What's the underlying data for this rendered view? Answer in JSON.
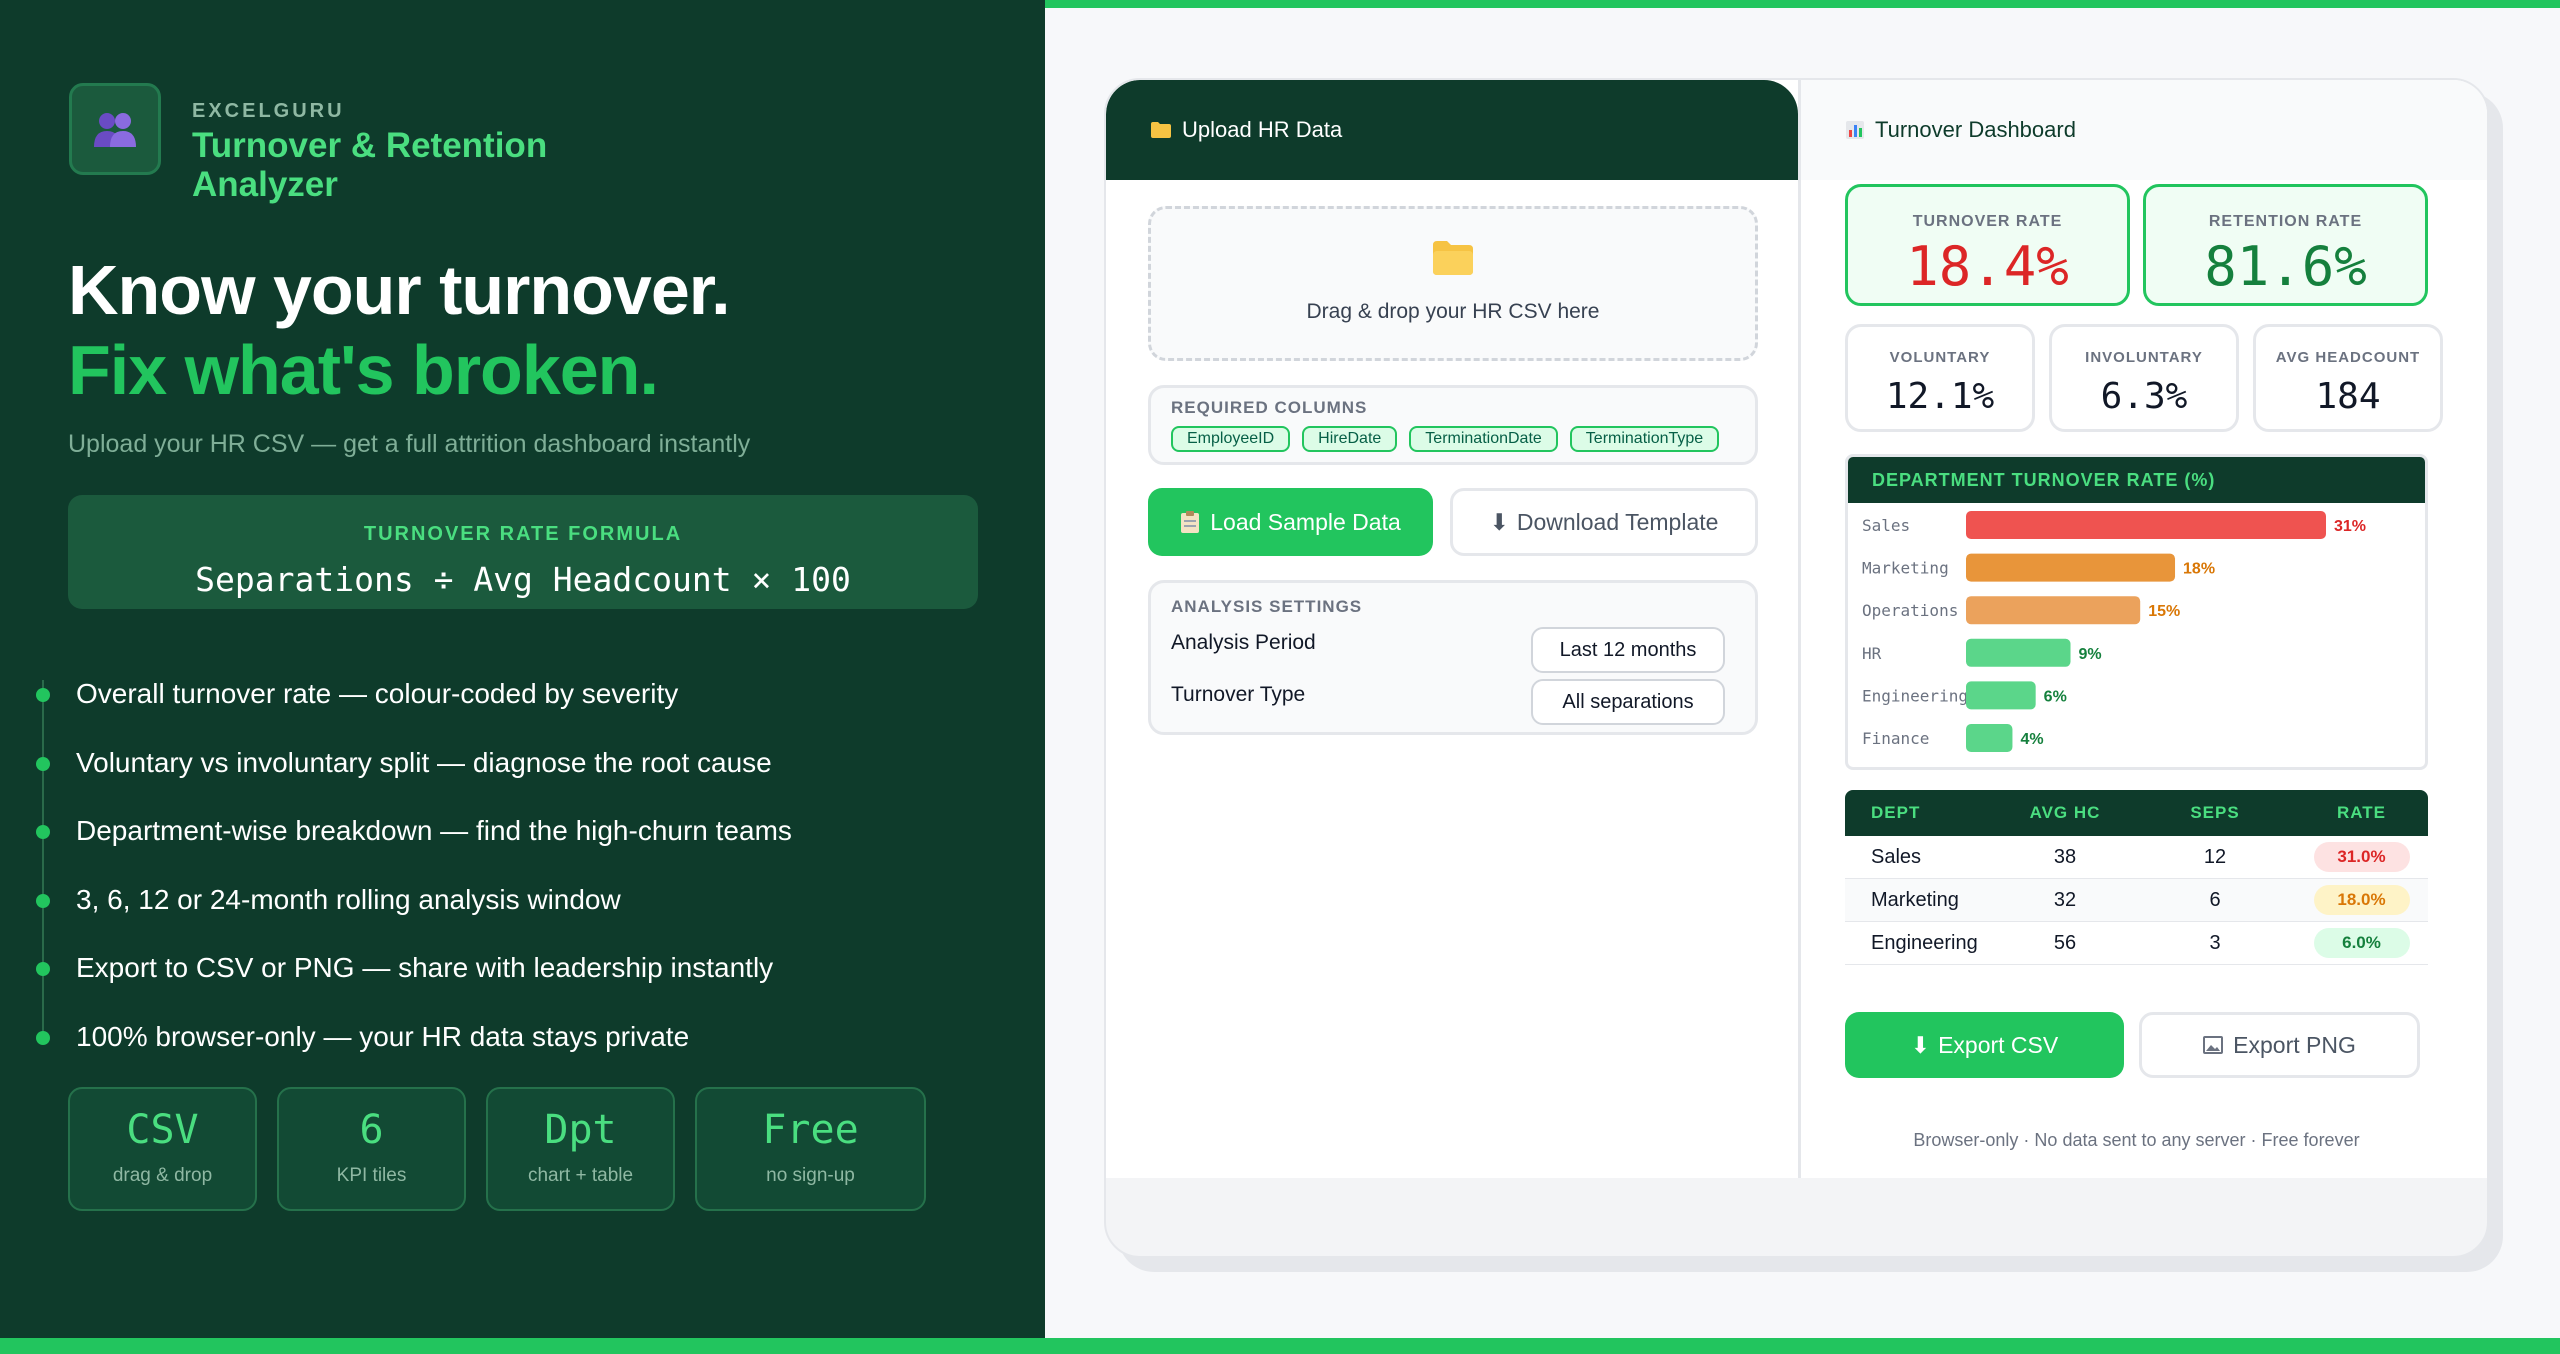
{
  "brand": {
    "company": "EXCELGURU",
    "title": "Turnover & Retention Analyzer"
  },
  "hero": {
    "line1": "Know your turnover.",
    "line2": "Fix what's broken.",
    "subtitle": "Upload your HR CSV — get a full attrition dashboard instantly"
  },
  "formula": {
    "label": "TURNOVER RATE FORMULA",
    "text": "Separations ÷ Avg Headcount × 100"
  },
  "features": [
    "Overall turnover rate — colour-coded by severity",
    "Voluntary vs involuntary split — diagnose the root cause",
    "Department-wise breakdown — find the high-churn teams",
    "3, 6, 12 or 24-month rolling analysis window",
    "Export to CSV or PNG — share with leadership instantly",
    "100% browser-only — your HR data stays private"
  ],
  "stats": [
    {
      "value": "CSV",
      "label": "drag & drop"
    },
    {
      "value": "6",
      "label": "KPI tiles"
    },
    {
      "value": "Dpt",
      "label": "chart + table"
    },
    {
      "value": "Free",
      "label": "no sign-up"
    }
  ],
  "upload": {
    "header": "Upload HR Data",
    "drop_text": "Drag & drop your HR CSV here",
    "required_label": "REQUIRED COLUMNS",
    "columns": [
      "EmployeeID",
      "HireDate",
      "TerminationDate",
      "TerminationType"
    ],
    "load_sample": "Load Sample Data",
    "download_template": "Download Template",
    "settings_label": "ANALYSIS SETTINGS",
    "period_label": "Analysis Period",
    "period_value": "Last 12 months",
    "type_label": "Turnover Type",
    "type_value": "All separations"
  },
  "dashboard": {
    "header": "Turnover Dashboard",
    "kpis": {
      "turnover_label": "TURNOVER RATE",
      "turnover_value": "18.4%",
      "retention_label": "RETENTION RATE",
      "retention_value": "81.6%",
      "voluntary_label": "VOLUNTARY",
      "voluntary_value": "12.1%",
      "involuntary_label": "INVOLUNTARY",
      "involuntary_value": "6.3%",
      "headcount_label": "AVG HEADCOUNT",
      "headcount_value": "184"
    },
    "table": {
      "headers": [
        "DEPT",
        "AVG HC",
        "SEPS",
        "RATE"
      ],
      "rows": [
        {
          "dept": "Sales",
          "hc": "38",
          "seps": "12",
          "rate": "31.0%"
        },
        {
          "dept": "Marketing",
          "hc": "32",
          "seps": "6",
          "rate": "18.0%"
        },
        {
          "dept": "Engineering",
          "hc": "56",
          "seps": "3",
          "rate": "6.0%"
        }
      ]
    },
    "export_csv": "Export CSV",
    "export_png": "Export PNG",
    "footer": "Browser-only · No data sent to any server · Free forever"
  },
  "colors": {
    "panel": "#0e3b2b",
    "accent": "#22c55e",
    "danger": "#dc2626",
    "high": "#ef5350",
    "medium": "#e8953a",
    "low": "#5bd68a"
  },
  "chart_data": {
    "type": "bar",
    "title": "DEPARTMENT TURNOVER RATE (%)",
    "orientation": "horizontal",
    "categories": [
      "Sales",
      "Marketing",
      "Operations",
      "HR",
      "Engineering",
      "Finance"
    ],
    "values": [
      31,
      18,
      15,
      9,
      6,
      4
    ],
    "value_labels": [
      "31%",
      "18%",
      "15%",
      "9%",
      "6%",
      "4%"
    ],
    "bar_colors": [
      "#ef5350",
      "#e8953a",
      "#eba25c",
      "#5bd68a",
      "#5bd68a",
      "#5bd68a"
    ],
    "label_colors": [
      "#dc2626",
      "#d97706",
      "#d97706",
      "#15803d",
      "#15803d",
      "#15803d"
    ],
    "xlim": [
      0,
      31
    ]
  }
}
